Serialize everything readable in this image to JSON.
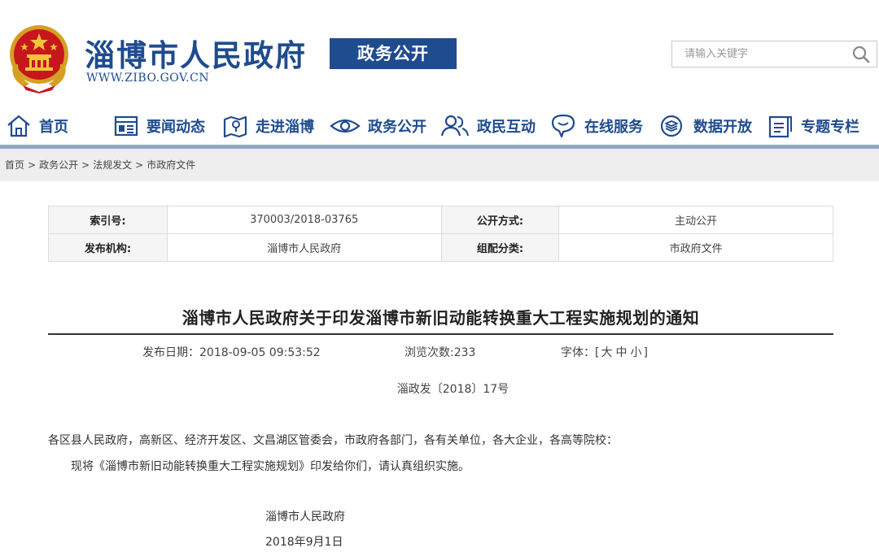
{
  "header": {
    "site_title": "淄博市人民政府",
    "site_url": "WWW.ZIBO.GOV.CN",
    "section_badge": "政务公开",
    "search": {
      "placeholder": "请输入关键字"
    }
  },
  "nav": {
    "items": [
      {
        "label": "首页",
        "icon": "home-icon"
      },
      {
        "label": "要闻动态",
        "icon": "news-icon"
      },
      {
        "label": "走进淄博",
        "icon": "map-icon"
      },
      {
        "label": "政务公开",
        "icon": "eye-icon"
      },
      {
        "label": "政民互动",
        "icon": "people-icon"
      },
      {
        "label": "在线服务",
        "icon": "service-icon"
      },
      {
        "label": "数据开放",
        "icon": "data-icon"
      },
      {
        "label": "专题专栏",
        "icon": "topic-icon"
      }
    ]
  },
  "breadcrumb": {
    "items": [
      "首页",
      "政务公开",
      "法规发文",
      "市政府文件"
    ],
    "separator": ">"
  },
  "meta": {
    "index_label": "索引号:",
    "index_value": "370003/2018-03765",
    "open_mode_label": "公开方式:",
    "open_mode_value": "主动公开",
    "publisher_label": "发布机构:",
    "publisher_value": "淄博市人民政府",
    "category_label": "组配分类:",
    "category_value": "市政府文件"
  },
  "article": {
    "title": "淄博市人民政府关于印发淄博市新旧动能转换重大工程实施规划的通知",
    "publish_date": "发布日期：2018-09-05 09:53:52",
    "views": "浏览次数:233",
    "font_label": "字体：[",
    "font_large": "大",
    "font_medium": "中",
    "font_small": "小",
    "font_end": "]",
    "doc_number": "淄政发〔2018〕17号",
    "recipients": "各区县人民政府，高新区、经济开发区、文昌湖区管委会，市政府各部门，各有关单位，各大企业，各高等院校：",
    "body": "现将《淄博市新旧动能转换重大工程实施规划》印发给你们，请认真组织实施。",
    "signature": "淄博市人民政府",
    "sign_date": "2018年9月1日"
  },
  "colors": {
    "brand_blue": "#1f4b8f",
    "nav_bar": "#8fa6c9",
    "breadcrumb_bg": "#eeeeee"
  }
}
